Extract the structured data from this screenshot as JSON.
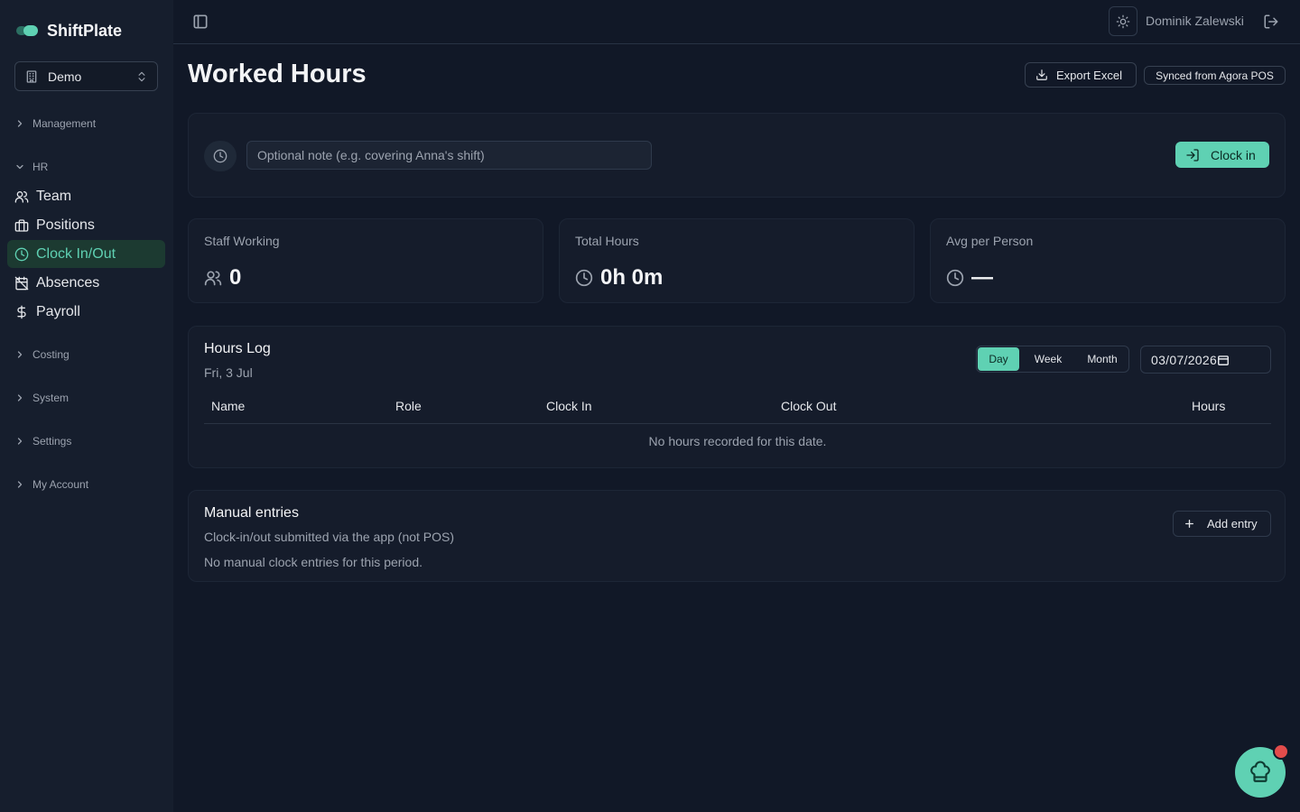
{
  "app": {
    "name": "ShiftPlate"
  },
  "sidebar": {
    "org_select": {
      "value": "Demo",
      "icon": "building-icon"
    },
    "groups": {
      "management": "Management",
      "hr": "HR",
      "costing": "Costing",
      "system": "System",
      "settings": "Settings",
      "account": "My Account"
    },
    "hr_items": [
      {
        "label": "Team",
        "icon": "users-icon"
      },
      {
        "label": "Positions",
        "icon": "briefcase-icon"
      },
      {
        "label": "Clock In/Out",
        "icon": "clock-icon",
        "active": true
      },
      {
        "label": "Absences",
        "icon": "calendar-off-icon"
      },
      {
        "label": "Payroll",
        "icon": "dollar-icon"
      }
    ]
  },
  "topbar": {
    "user_name": "Dominik Zalewski"
  },
  "page": {
    "title": "Worked Hours",
    "export_label": "Export Excel",
    "sync_badge": "Synced from Agora POS"
  },
  "clock_card": {
    "note_placeholder": "Optional note (e.g. covering Anna's shift)",
    "note_value": "",
    "clock_in_label": "Clock in"
  },
  "stats": [
    {
      "label": "Staff Working",
      "value": "0",
      "icon": "users-icon"
    },
    {
      "label": "Total Hours",
      "value": "0h 0m",
      "icon": "clock-icon"
    },
    {
      "label": "Avg per Person",
      "value": "—",
      "icon": "clock-icon"
    }
  ],
  "hours_log": {
    "title": "Hours Log",
    "date_label": "Fri, 3 Jul",
    "range_options": [
      "Day",
      "Week",
      "Month"
    ],
    "range_selected": "Day",
    "date_value": "03/07/2026",
    "columns": [
      "Name",
      "Role",
      "Clock In",
      "Clock Out",
      "Hours"
    ],
    "empty_text": "No hours recorded for this date."
  },
  "manual": {
    "title": "Manual entries",
    "subtitle": "Clock-in/out submitted via the app (not POS)",
    "empty_text": "No manual clock entries for this period.",
    "add_label": "Add entry"
  },
  "colors": {
    "background": "#111827",
    "sidebar": "#161e2d",
    "card": "#151c2b",
    "accent": "#5fd1b3",
    "notification": "#e24c4b"
  }
}
